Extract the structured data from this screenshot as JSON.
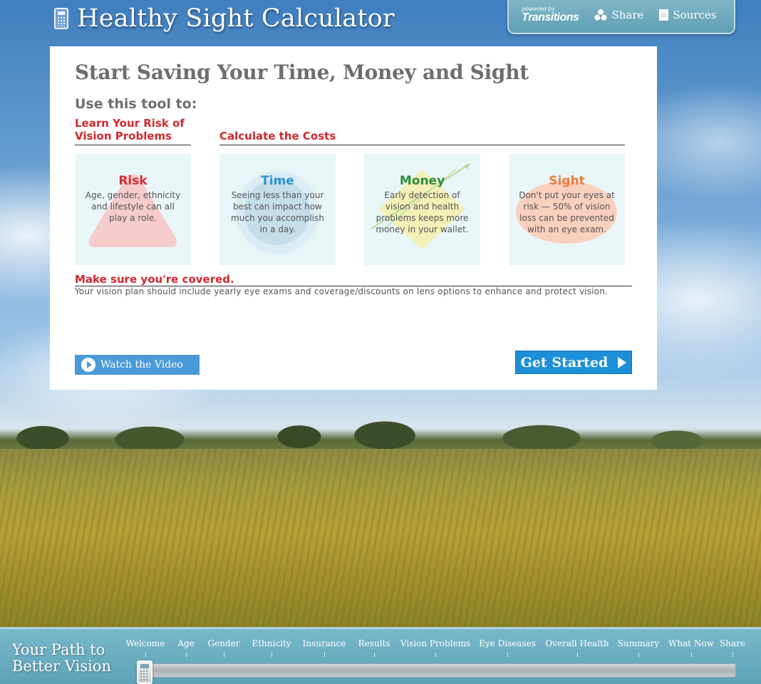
{
  "header": {
    "title": "Healthy Sight Calculator",
    "powered_by": "powered by",
    "brand": "Transitions",
    "share_label": "Share",
    "sources_label": "Sources"
  },
  "card": {
    "heading": "Start Saving Your Time, Money and Sight",
    "tool_label": "Use this tool to:",
    "learn_heading": "Learn Your Risk of Vision Problems",
    "calc_heading": "Calculate the Costs",
    "tiles": [
      {
        "title": "Risk",
        "color": "#d62f35",
        "text": "Age, gender, ethnicity and lifestyle can all play a role."
      },
      {
        "title": "Time",
        "color": "#2a94cf",
        "text": "Seeing less than your best can impact how much you accomplish in a day."
      },
      {
        "title": "Money",
        "color": "#2e8b3a",
        "text": "Early detection of vision and health problems keeps more money in your wallet."
      },
      {
        "title": "Sight",
        "color": "#f07a3c",
        "text": "Don't put your eyes at risk — 50% of vision loss can be prevented with an eye exam."
      }
    ],
    "covered_heading": "Make sure you're covered.",
    "covered_text": "Your vision plan should include yearly eye exams and coverage/discounts on lens options to enhance and protect vision.",
    "video_button": "Watch the Video",
    "start_button": "Get Started"
  },
  "footer": {
    "path_title": "Your Path to Better Vision",
    "steps": [
      "Welcome",
      "Age",
      "Gender",
      "Ethnicity",
      "Insurance",
      "Results",
      "Vision Problems",
      "Eye Diseases",
      "Overall Health",
      "Summary",
      "What Now",
      "Share"
    ],
    "progress": 0
  }
}
